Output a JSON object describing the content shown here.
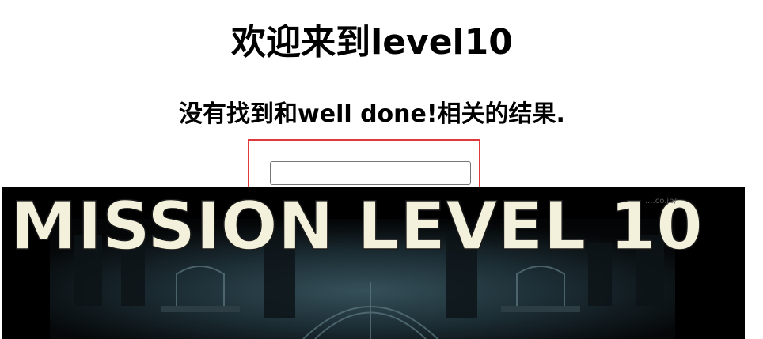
{
  "page": {
    "title": "欢迎来到level10",
    "result_text": "没有找到和well done!相关的结果."
  },
  "search": {
    "value": "",
    "placeholder": ""
  },
  "banner": {
    "text": "MISSION LEVEL 10",
    "watermark": "....co.jp/",
    "text_color": "#f3f1dc",
    "background_color": "#000000"
  },
  "highlight": {
    "color": "#e0393c"
  }
}
